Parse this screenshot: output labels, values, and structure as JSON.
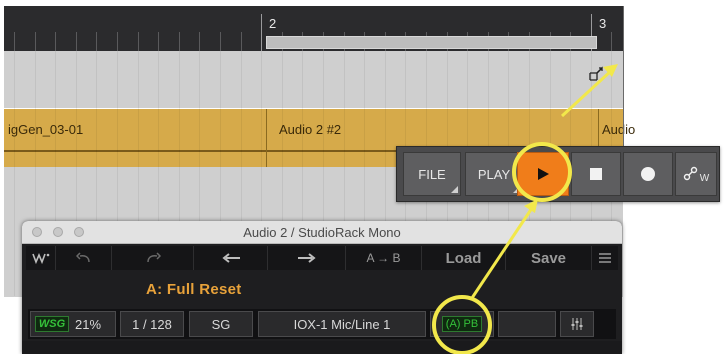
{
  "timeline": {
    "bar_2": "2",
    "bar_3": "3",
    "clips": [
      {
        "label": "igGen_03-01"
      },
      {
        "label": "Audio 2 #2"
      },
      {
        "label": "Audio"
      }
    ]
  },
  "transport": {
    "file_label": "FILE",
    "play_label": "PLAY",
    "w_label": "W"
  },
  "plugin": {
    "window_title": "Audio 2 / StudioRack Mono",
    "arrow_ab": "A → B",
    "load_label": "Load",
    "save_label": "Save",
    "preset_name": "A: Full Reset",
    "cells": {
      "wsg_tag": "WSG",
      "wsg_value": "21%",
      "page": "1 / 128",
      "sg": "SG",
      "input": "IOX-1 Mic/Line 1",
      "pb": "(A) PB"
    }
  },
  "colors": {
    "accent_play": "#f07d1a",
    "highlight_ring": "#f2e84b",
    "clip": "#d6aa4a",
    "preset_text": "#e8a23a",
    "pb_green": "#35c23a"
  }
}
